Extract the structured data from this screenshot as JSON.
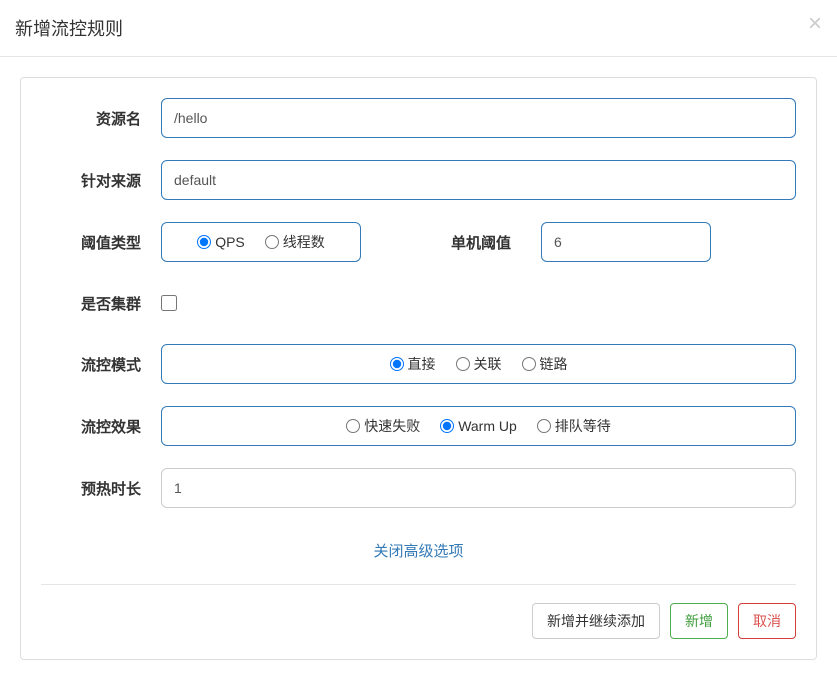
{
  "modal": {
    "title": "新增流控规则",
    "close": "×"
  },
  "form": {
    "resourceName": {
      "label": "资源名",
      "value": "/hello"
    },
    "source": {
      "label": "针对来源",
      "value": "default"
    },
    "thresholdType": {
      "label": "阈值类型",
      "options": {
        "qps": "QPS",
        "thread": "线程数"
      },
      "selected": "qps"
    },
    "threshold": {
      "label": "单机阈值",
      "value": "6"
    },
    "cluster": {
      "label": "是否集群",
      "checked": false
    },
    "flowMode": {
      "label": "流控模式",
      "options": {
        "direct": "直接",
        "relate": "关联",
        "chain": "链路"
      },
      "selected": "direct"
    },
    "flowEffect": {
      "label": "流控效果",
      "options": {
        "fast": "快速失败",
        "warmup": "Warm Up",
        "queue": "排队等待"
      },
      "selected": "warmup"
    },
    "warmupTime": {
      "label": "预热时长",
      "value": "1"
    },
    "advancedLink": "关闭高级选项"
  },
  "footer": {
    "addContinue": "新增并继续添加",
    "add": "新增",
    "cancel": "取消"
  }
}
